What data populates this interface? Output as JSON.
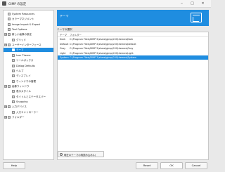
{
  "window": {
    "title": "GIMP の設定",
    "minimize_glyph": "‒",
    "maximize_glyph": "□",
    "close_glyph": "✕",
    "app_icon": "gimp-icon"
  },
  "sidebar": {
    "items": [
      {
        "label": "System Resources",
        "icon": "chip-icon",
        "expander": ""
      },
      {
        "label": "カラーマネジメント",
        "icon": "color-icon",
        "expander": ""
      },
      {
        "label": "Image Import & Export",
        "icon": "import-icon",
        "expander": ""
      },
      {
        "label": "Tool Options",
        "icon": "tool-icon",
        "expander": ""
      },
      {
        "label": "新しい画像の設定",
        "icon": "new-image-icon",
        "expander": "⊟"
      },
      {
        "label": "グリッド",
        "icon": "grid-icon",
        "expander": ""
      },
      {
        "label": "ユーザーインターフェース",
        "icon": "interface-icon",
        "expander": "⊟"
      },
      {
        "label": "テーマ",
        "icon": "theme-icon",
        "expander": ""
      },
      {
        "label": "Icon Theme",
        "icon": "icon-theme-icon",
        "expander": ""
      },
      {
        "label": "ツールボックス",
        "icon": "toolbox-icon",
        "expander": ""
      },
      {
        "label": "Dialog Defaults",
        "icon": "dialog-icon",
        "expander": ""
      },
      {
        "label": "ヘルプ",
        "icon": "help-icon",
        "expander": ""
      },
      {
        "label": "ディスプレイ",
        "icon": "display-icon",
        "expander": ""
      },
      {
        "label": "ウィンドウの管理",
        "icon": "window-icon",
        "expander": ""
      },
      {
        "label": "画像ウィンドウ",
        "icon": "image-window-icon",
        "expander": "⊟"
      },
      {
        "label": "表示スタイル",
        "icon": "appearance-icon",
        "expander": ""
      },
      {
        "label": "タイトルとステータスバー",
        "icon": "title-icon",
        "expander": ""
      },
      {
        "label": "Snapping",
        "icon": "snap-icon",
        "expander": ""
      },
      {
        "label": "入力デバイス",
        "icon": "input-device-icon",
        "expander": "⊟"
      },
      {
        "label": "入力コントローラー",
        "icon": "controller-icon",
        "expander": ""
      },
      {
        "label": "フォルダー",
        "icon": "folder-icon",
        "expander": "⊞"
      }
    ],
    "selected_label": "テーマ"
  },
  "main": {
    "banner_title": "テーマ",
    "section_heading": "テーマの選択",
    "columns": [
      "テーマ",
      "フォルダー"
    ],
    "rows": [
      {
        "theme": "Dark",
        "folder": "C:\\Program Files\\GIMP 2\\share\\gimp\\2.0\\themes\\Dark"
      },
      {
        "theme": "Default",
        "folder": "C:\\Program Files\\GIMP 2\\share\\gimp\\2.0\\themes\\Default"
      },
      {
        "theme": "Gray",
        "folder": "C:\\Program Files\\GIMP 2\\share\\gimp\\2.0\\themes\\Gray"
      },
      {
        "theme": "Light",
        "folder": "C:\\Program Files\\GIMP 2\\share\\gimp\\2.0\\themes\\Light"
      },
      {
        "theme": "System",
        "folder": "C:\\Program Files\\GIMP 2\\share\\gimp\\2.0\\themes\\System"
      }
    ],
    "selected_theme": "System",
    "reload_label": "現在のテーマの再読み込み(L)"
  },
  "buttons": {
    "help": "Help",
    "reset": "Reset",
    "ok": "OK",
    "cancel": "Cancel"
  },
  "colors": {
    "accent": "#1f8de0"
  }
}
